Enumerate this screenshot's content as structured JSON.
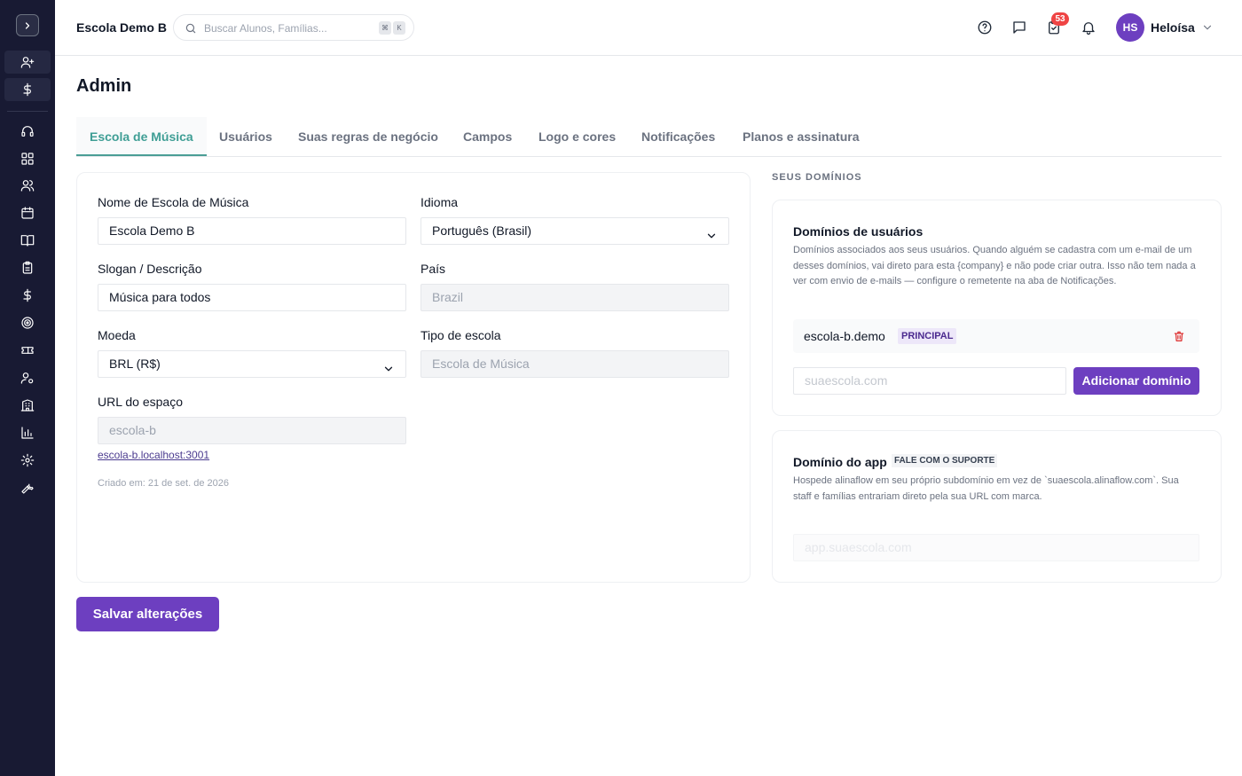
{
  "header": {
    "school_name": "Escola Demo B",
    "search_placeholder": "Buscar Alunos, Famílias...",
    "shortcut_key1": "⌘",
    "shortcut_key2": "K",
    "tasks_badge": "53",
    "user_initials": "HS",
    "user_name": "Heloísa"
  },
  "page": {
    "title": "Admin",
    "tabs": [
      {
        "label": "Escola de Música",
        "active": true
      },
      {
        "label": "Usuários"
      },
      {
        "label": "Suas regras de negócio"
      },
      {
        "label": "Campos"
      },
      {
        "label": "Logo e cores"
      },
      {
        "label": "Notificações"
      },
      {
        "label": "Planos e assinatura"
      }
    ]
  },
  "form": {
    "school_name_label": "Nome de Escola de Música",
    "school_name_value": "Escola Demo B",
    "language_label": "Idioma",
    "language_value": "Português (Brasil)",
    "slogan_label": "Slogan / Descrição",
    "slogan_value": "Música para todos",
    "country_label": "País",
    "country_value": "Brazil",
    "currency_label": "Moeda",
    "currency_value": "BRL (R$)",
    "school_type_label": "Tipo de escola",
    "school_type_value": "Escola de Música",
    "space_url_label": "URL do espaço",
    "space_url_value": "escola-b",
    "space_url_link": "escola-b.localhost:3001",
    "created_text": "Criado em: 21 de set. de 2026",
    "save_label": "Salvar alterações"
  },
  "domains": {
    "section_heading": "SEUS DOMÍNIOS",
    "user_domains_title": "Domínios de usuários",
    "user_domains_desc": "Domínios associados aos seus usuários. Quando alguém se cadastra com um e-mail de um desses domínios, vai direto para esta {company} e não pode criar outra. Isso não tem nada a ver com envio de e-mails — configure o remetente na aba de Notificações.",
    "domain_name": "escola-b.demo",
    "domain_badge": "PRINCIPAL",
    "new_domain_placeholder": "suaescola.com",
    "add_domain_label": "Adicionar domínio",
    "app_domain_title": "Domínio do app",
    "app_domain_badge": "FALE COM O SUPORTE",
    "app_domain_desc": "Hospede alinaflow em seu próprio subdomínio em vez de `suaescola.alinaflow.com`. Sua staff e famílias entrariam direto pela sua URL com marca.",
    "app_domain_placeholder": "app.suaescola.com"
  },
  "colors": {
    "sidebar_bg": "#181a33",
    "accent_purple": "#6d3fc0",
    "active_tab": "#3f9e95",
    "badge_red": "#ef4444"
  },
  "icons": {
    "sidebar": [
      "chevron-right-icon",
      "user-plus-icon",
      "dollar-icon",
      "headset-icon",
      "grid-icon",
      "users-icon",
      "calendar-icon",
      "book-icon",
      "clipboard-icon",
      "dollar-icon",
      "target-icon",
      "ticket-icon",
      "user-cog-icon",
      "building-icon",
      "bar-chart-icon",
      "gear-icon",
      "wrench-icon"
    ],
    "header": [
      "help-icon",
      "chat-icon",
      "tasks-icon",
      "bell-icon"
    ]
  }
}
